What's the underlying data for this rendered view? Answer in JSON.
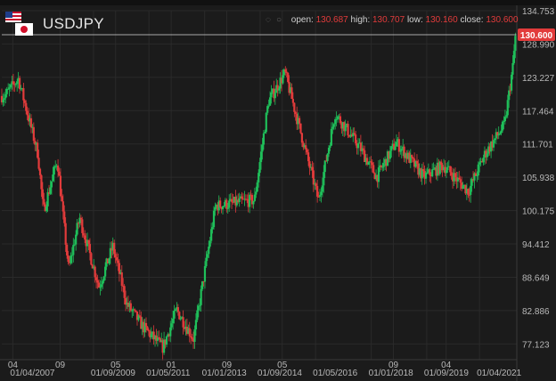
{
  "header": {
    "symbol": "USDJPY",
    "open_label": "open:",
    "open_value": "130.687",
    "high_label": "high:",
    "high_value": "130.707",
    "low_label": "low:",
    "low_value": "130.160",
    "close_label": "close:",
    "close_value": "130.600"
  },
  "colors": {
    "up": "#1fbf5a",
    "down": "#e23b3b",
    "background": "#1b1b1b",
    "grid": "#2a2a2a",
    "price_tag": "#e23b3b"
  },
  "icons": [
    "us-flag-icon",
    "japan-flag-icon",
    "eye-icon",
    "settings-icon"
  ],
  "chart_data": {
    "type": "candlestick",
    "symbol": "USDJPY",
    "ylim": [
      74.4,
      134.753
    ],
    "y_ticks": [
      "134.753",
      "128.990",
      "123.227",
      "117.464",
      "111.701",
      "105.938",
      "100.175",
      "94.412",
      "88.649",
      "82.886",
      "77.123"
    ],
    "current_price": "130.600",
    "grid": true,
    "x_ticks": [
      {
        "x": "2007-04-01",
        "label": "04"
      },
      {
        "x": "2007-04-01",
        "label": "01/04/2007"
      },
      {
        "x": "2008-09-01",
        "label": "09"
      },
      {
        "x": "2009-09-01",
        "label": "01/09/2009"
      },
      {
        "x": "2010-05-01",
        "label": "05"
      },
      {
        "x": "2011-05-01",
        "label": "01/05/2011"
      },
      {
        "x": "2012-01-01",
        "label": "01"
      },
      {
        "x": "2013-01-01",
        "label": "01/01/2013"
      },
      {
        "x": "2013-09-01",
        "label": "09"
      },
      {
        "x": "2014-09-01",
        "label": "01/09/2014"
      },
      {
        "x": "2015-05-01",
        "label": "05"
      },
      {
        "x": "2016-05-01",
        "label": "01/05/2016"
      },
      {
        "x": "2018-01-01",
        "label": "01/01/2018"
      },
      {
        "x": "2018-09-01",
        "label": "09"
      },
      {
        "x": "2019-09-01",
        "label": "01/09/2019"
      },
      {
        "x": "2020-04-01",
        "label": "04"
      },
      {
        "x": "2021-04-01",
        "label": "01/04/2021"
      }
    ],
    "keypoints": [
      {
        "date": "2007-01-01",
        "close": 120.0
      },
      {
        "date": "2007-06-01",
        "close": 123.0
      },
      {
        "date": "2008-01-01",
        "close": 110.0
      },
      {
        "date": "2008-03-01",
        "close": 100.0
      },
      {
        "date": "2008-08-01",
        "close": 109.0
      },
      {
        "date": "2008-12-01",
        "close": 90.0
      },
      {
        "date": "2009-04-01",
        "close": 99.0
      },
      {
        "date": "2009-11-01",
        "close": 87.0
      },
      {
        "date": "2010-04-01",
        "close": 94.0
      },
      {
        "date": "2010-09-01",
        "close": 84.0
      },
      {
        "date": "2011-03-01",
        "close": 80.0
      },
      {
        "date": "2011-10-01",
        "close": 76.5
      },
      {
        "date": "2012-03-01",
        "close": 83.0
      },
      {
        "date": "2012-09-01",
        "close": 78.0
      },
      {
        "date": "2013-05-01",
        "close": 101.0
      },
      {
        "date": "2014-07-01",
        "close": 102.0
      },
      {
        "date": "2014-12-01",
        "close": 119.0
      },
      {
        "date": "2015-06-01",
        "close": 124.0
      },
      {
        "date": "2016-06-01",
        "close": 102.0
      },
      {
        "date": "2016-12-01",
        "close": 117.0
      },
      {
        "date": "2017-09-01",
        "close": 111.0
      },
      {
        "date": "2018-03-01",
        "close": 106.0
      },
      {
        "date": "2018-10-01",
        "close": 112.0
      },
      {
        "date": "2019-08-01",
        "close": 106.0
      },
      {
        "date": "2020-03-01",
        "close": 108.0
      },
      {
        "date": "2020-12-01",
        "close": 103.5
      },
      {
        "date": "2021-06-01",
        "close": 110.0
      },
      {
        "date": "2022-01-01",
        "close": 115.0
      },
      {
        "date": "2022-04-01",
        "close": 125.0
      },
      {
        "date": "2022-05-01",
        "close": 130.6
      }
    ]
  }
}
